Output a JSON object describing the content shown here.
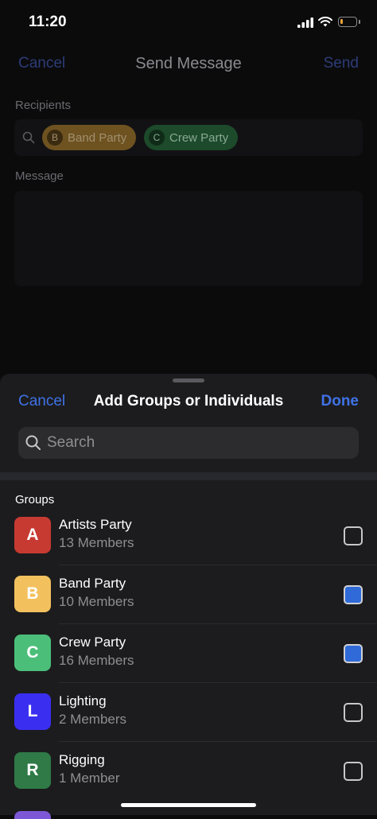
{
  "status": {
    "time": "11:20"
  },
  "background": {
    "cancel": "Cancel",
    "title": "Send Message",
    "send": "Send",
    "recipients_label": "Recipients",
    "message_label": "Message",
    "chips": [
      {
        "letter": "B",
        "label": "Band Party"
      },
      {
        "letter": "C",
        "label": "Crew Party"
      }
    ]
  },
  "sheet": {
    "cancel": "Cancel",
    "title": "Add Groups or Individuals",
    "done": "Done",
    "search_placeholder": "Search",
    "groups_label": "Groups",
    "groups": [
      {
        "letter": "A",
        "name": "Artists Party",
        "members": "13 Members",
        "color": "#c73a32",
        "checked": false
      },
      {
        "letter": "B",
        "name": "Band Party",
        "members": "10 Members",
        "color": "#f2c15e",
        "checked": true
      },
      {
        "letter": "C",
        "name": "Crew Party",
        "members": "16 Members",
        "color": "#4bbf7a",
        "checked": true
      },
      {
        "letter": "L",
        "name": "Lighting",
        "members": "2 Members",
        "color": "#3a2ff0",
        "checked": false
      },
      {
        "letter": "R",
        "name": "Rigging",
        "members": "1 Member",
        "color": "#2f7a47",
        "checked": false
      }
    ]
  }
}
